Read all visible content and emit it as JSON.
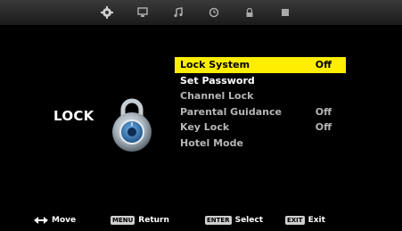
{
  "tabs": [
    {
      "icon": "gear-icon",
      "active": true
    },
    {
      "icon": "monitor-icon",
      "active": false
    },
    {
      "icon": "music-note-icon",
      "active": false
    },
    {
      "icon": "clock-icon",
      "active": false
    },
    {
      "icon": "lock-icon",
      "active": false
    },
    {
      "icon": "square-icon",
      "active": false
    }
  ],
  "section": {
    "title": "LOCK"
  },
  "menu": {
    "items": [
      {
        "label": "Lock System",
        "value": "Off",
        "selected": true
      },
      {
        "label": "Set Password",
        "value": ""
      },
      {
        "label": "Channel Lock",
        "value": ""
      },
      {
        "label": "Parental Guidance",
        "value": "Off"
      },
      {
        "label": "Key Lock",
        "value": "Off"
      },
      {
        "label": "Hotel Mode",
        "value": ""
      }
    ]
  },
  "footer": {
    "move": "Move",
    "menu_key": "MENU",
    "return": "Return",
    "enter_key": "ENTER",
    "select": "Select",
    "exit_key": "EXIT",
    "exit": "Exit"
  },
  "colors": {
    "highlight": "#ffee00",
    "background": "#000000"
  }
}
